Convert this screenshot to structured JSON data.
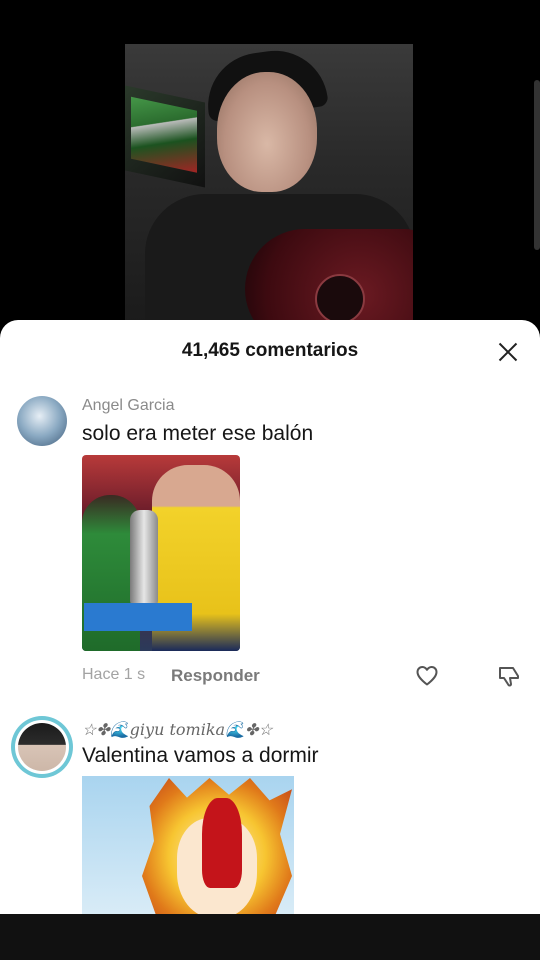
{
  "sheet": {
    "comment_count": "41,465 comentarios"
  },
  "comments": [
    {
      "username": "Angel Garcia",
      "text": "solo era meter ese balón",
      "time": "Hace 1 s",
      "reply_label": "Responder"
    },
    {
      "username": "☆✤🌊giyu tomika🌊✤☆",
      "text": "Valentina vamos a dormir"
    }
  ],
  "icons": {
    "close": "close-icon",
    "like": "heart-icon",
    "dislike": "thumbs-down-icon"
  },
  "colors": {
    "sheet_bg": "#ffffff",
    "text_primary": "#161616",
    "text_secondary": "#8a8a8a",
    "avatar_ring": "#6ec7d6"
  }
}
